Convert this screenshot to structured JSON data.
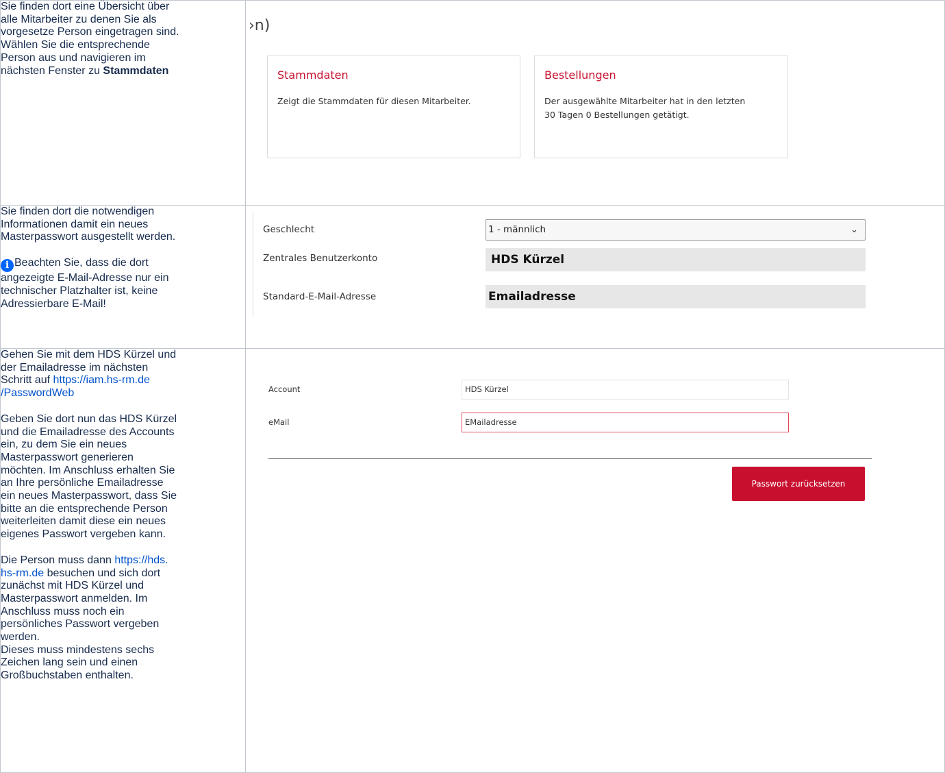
{
  "rows": [
    {
      "left": {
        "text_lines": [
          "Sie finden dort eine Übersicht über",
          "alle Mitarbeiter zu denen Sie als",
          "vorgesetze Person eingetragen sind.",
          "Wählen Sie die entsprechende",
          "Person aus und navigieren im"
        ],
        "last_line_prefix": "nächsten Fenster zu ",
        "last_line_bold": "Stammdaten"
      },
      "right": {
        "title_fragment": "›n)",
        "cards": [
          {
            "title": "Stammdaten",
            "text": "Zeigt die Stammdaten für diesen Mitarbeiter."
          },
          {
            "title": "Bestellungen",
            "text_lines": [
              "Der ausgewählte Mitarbeiter hat in den letzten",
              "30 Tagen 0 Bestellungen getätigt."
            ]
          }
        ]
      }
    },
    {
      "left": {
        "p1_lines": [
          "Sie finden dort die notwendigen",
          "Informationen damit ein neues",
          "Masterpasswort ausgestellt werden."
        ],
        "note_lines": [
          "Beachten Sie, dass die dort",
          "angezeigte E-Mail-Adresse nur ein",
          "technischer Platzhalter ist, keine",
          "Adressierbare E-Mail!"
        ],
        "icon": "info-icon"
      },
      "right": {
        "fields": [
          {
            "label": "Geschlecht",
            "value": "1 - männlich",
            "type": "select"
          },
          {
            "label": "Zentrales Benutzerkonto",
            "value": "HDS Kürzel",
            "type": "readonly"
          },
          {
            "label": "Standard-E-Mail-Adresse",
            "value": "Emailadresse",
            "type": "readonly"
          }
        ]
      }
    },
    {
      "left": {
        "p1_lines": [
          "Gehen Sie mit dem HDS Kürzel und",
          "der Emailadresse im nächsten"
        ],
        "p1_link_prefix": "Schritt auf ",
        "p1_link_text_1": "https://iam.hs-rm.de",
        "p1_link_text_2": "/PasswordWeb",
        "p2_lines": [
          "Geben Sie dort nun das HDS Kürzel",
          "und die Emailadresse des Accounts",
          "ein, zu dem Sie ein neues",
          "Masterpasswort generieren",
          "möchten. Im Anschluss erhalten Sie",
          "an Ihre persönliche Emailadresse",
          "ein neues Masterpasswort, dass Sie",
          "bitte an die entsprechende Person",
          "weiterleiten damit diese ein neues",
          "eigenes Passwort vergeben kann."
        ],
        "p3_prefix": "Die Person muss dann ",
        "p3_link_1": "https://hds.",
        "p3_link_2": "hs-rm.de",
        "p3_after_link": " besuchen und sich dort",
        "p3_lines": [
          "zunächst mit HDS Kürzel und",
          "Masterpasswort anmelden. Im",
          "Anschluss muss noch ein",
          "persönliches Passwort vergeben",
          "werden.",
          "Dieses muss mindestens sechs",
          "Zeichen lang sein und einen",
          "Großbuchstaben enthalten."
        ]
      },
      "right": {
        "account_label": "Account",
        "account_value": "HDS Kürzel",
        "email_label": "eMail",
        "email_value": "EMailadresse",
        "button_label": "Passwort zurücksetzen"
      }
    }
  ]
}
